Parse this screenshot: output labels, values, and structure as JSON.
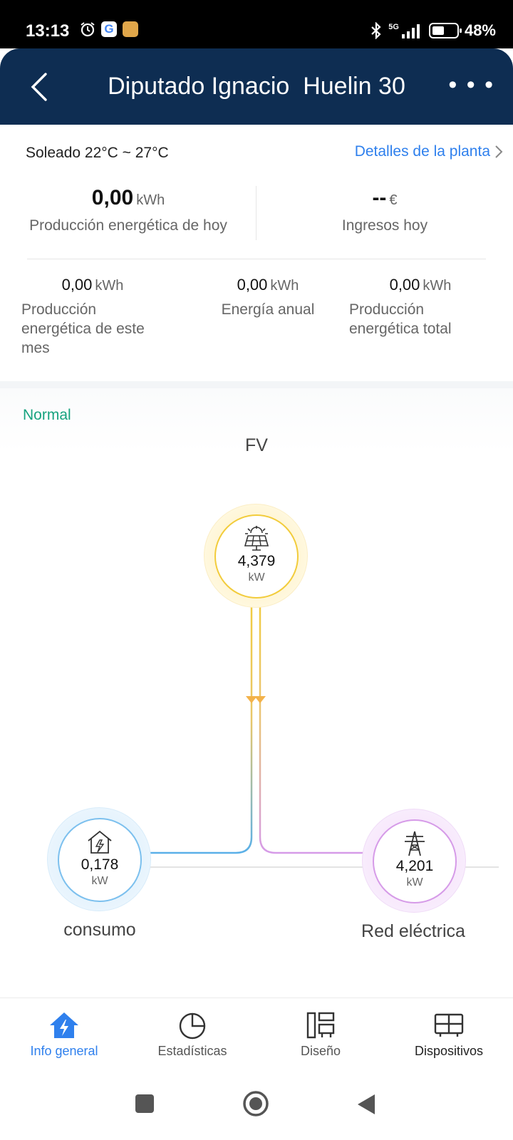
{
  "status_bar": {
    "time": "13:13",
    "network": "5G",
    "battery": "48%",
    "battery_level": 0.48
  },
  "header": {
    "title": "Diputado Ignacio  Huelin 30"
  },
  "summary": {
    "weather": "Soleado 22°C ~ 27°C",
    "details_link": "Detalles de la planta",
    "today_production": {
      "value": "0,00",
      "unit": "kWh",
      "label": "Producción energética de hoy"
    },
    "today_income": {
      "value": "--",
      "unit": "€",
      "label": "Ingresos hoy"
    },
    "month_production": {
      "value": "0,00",
      "unit": "kWh",
      "label": "Producción energética de este mes"
    },
    "annual_energy": {
      "value": "0,00",
      "unit": "kWh",
      "label": "Energía anual"
    },
    "total_production": {
      "value": "0,00",
      "unit": "kWh",
      "label": "Producción energética total"
    }
  },
  "flow": {
    "status": "Normal",
    "pv": {
      "label": "FV",
      "value": "4,379",
      "unit": "kW"
    },
    "consumption": {
      "label": "consumo",
      "value": "0,178",
      "unit": "kW"
    },
    "grid": {
      "label": "Red eléctrica",
      "value": "4,201",
      "unit": "kW"
    }
  },
  "tabs": [
    {
      "label": "Info general",
      "icon": "home-bolt-icon",
      "active": true
    },
    {
      "label": "Estadísticas",
      "icon": "pie-chart-icon",
      "active": false
    },
    {
      "label": "Diseño",
      "icon": "layout-icon",
      "active": false
    },
    {
      "label": "Dispositivos",
      "icon": "devices-icon",
      "active": false
    }
  ],
  "colors": {
    "header_bg": "#0e2d52",
    "accent_blue": "#2f80ed",
    "status_green": "#17a37f",
    "pv_yellow": "#f2cc3c",
    "consumption_blue": "#5ab0e8",
    "grid_purple": "#d69be8"
  }
}
